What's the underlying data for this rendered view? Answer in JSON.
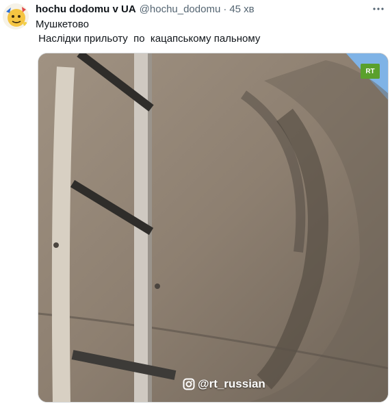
{
  "tweet": {
    "display_name": "hochu dodomu v UA",
    "handle": "@hochu_dodomu",
    "separator": "·",
    "timestamp": "45 хв",
    "more_icon": "ellipsis-icon",
    "text_line_1": "Мушкетово",
    "text_line_2": " Наслідки прильоту  по  кацапському пальному"
  },
  "media": {
    "logo_text": "RT",
    "logo_color": "#5aa02c",
    "watermark_text": "@rt_russian",
    "watermark_icon": "instagram-icon"
  }
}
